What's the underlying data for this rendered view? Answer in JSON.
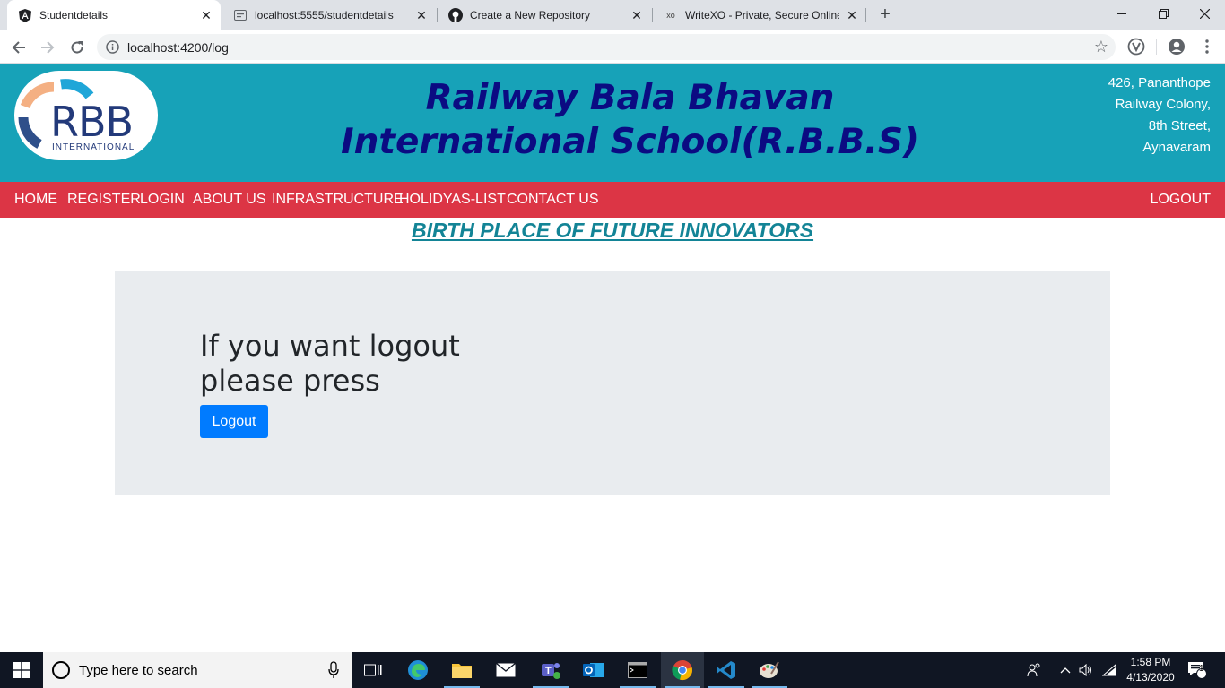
{
  "browser": {
    "tabs": [
      {
        "title": "Studentdetails",
        "active": true
      },
      {
        "title": "localhost:5555/studentdetails",
        "active": false
      },
      {
        "title": "Create a New Repository",
        "active": false
      },
      {
        "title": "WriteXO - Private, Secure Online",
        "active": false
      }
    ],
    "url": "localhost:4200/log"
  },
  "header": {
    "logo_text": "RBB",
    "logo_subtext": "INTERNATIONAL",
    "title": "Railway Bala Bhavan International School(R.B.B.S)",
    "address_lines": [
      "426, Pananthope",
      "Railway Colony,",
      "8th Street,",
      "Aynavaram"
    ]
  },
  "nav": {
    "items": [
      "HOME",
      "REGISTER",
      "LOGIN",
      "ABOUT US",
      "INFRASTRUCTURE",
      "HOLIDYAS-LIST",
      "CONTACT US"
    ],
    "logout": "LOGOUT"
  },
  "tagline": "BIRTH PLACE OF FUTURE INNOVATORS",
  "main": {
    "heading": "If you want logout please press",
    "button_label": "Logout"
  },
  "taskbar": {
    "search_placeholder": "Type here to search",
    "time": "1:58 PM",
    "date": "4/13/2020",
    "notification_count": "1"
  },
  "colors": {
    "header_bg": "#17a2b8",
    "nav_bg": "#dc3545",
    "title_color": "#0b0b82",
    "tagline_color": "#138496",
    "button_bg": "#007bff",
    "jumbotron_bg": "#e9ecef"
  }
}
